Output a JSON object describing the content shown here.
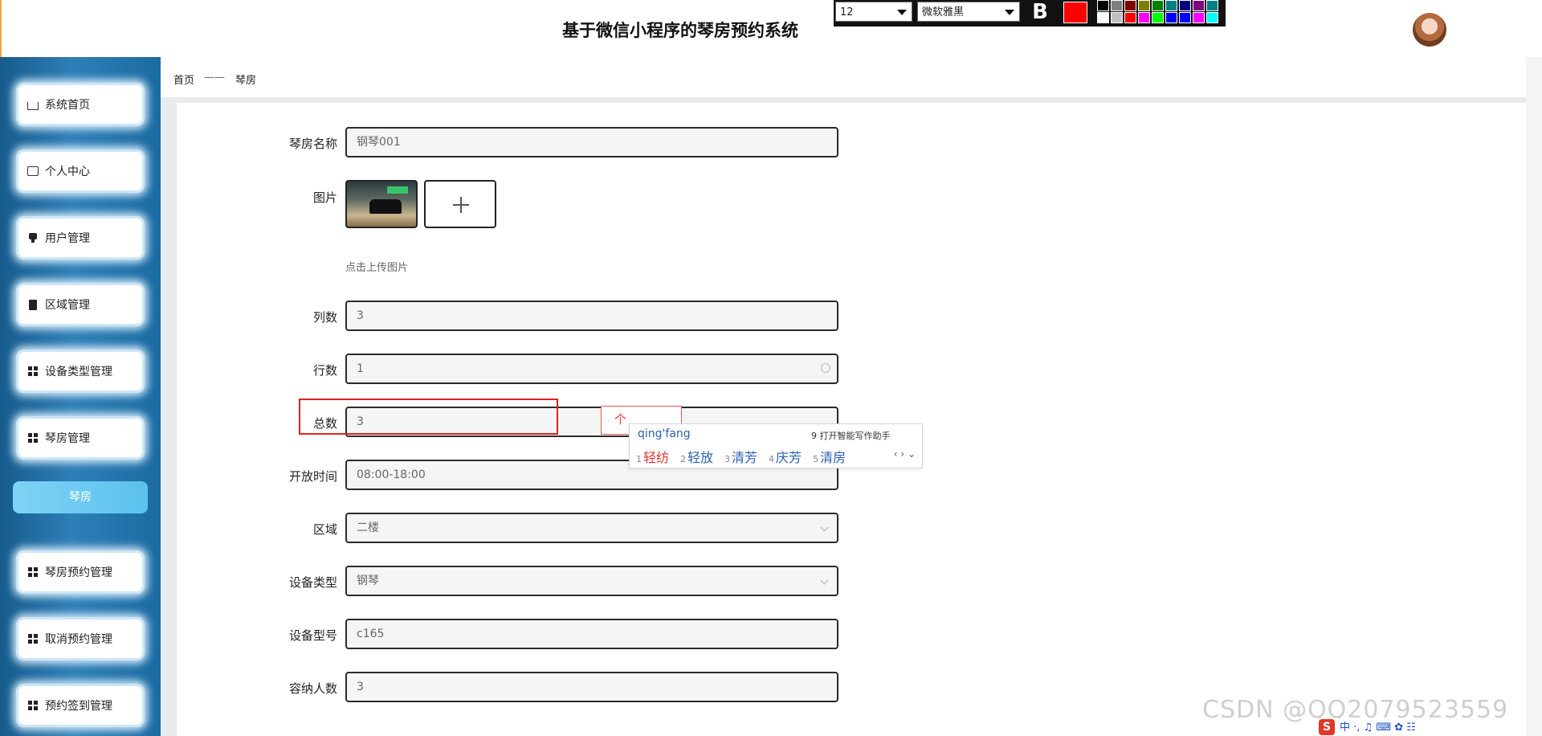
{
  "header": {
    "title": "基于微信小程序的琴房预约系统"
  },
  "text_toolbar": {
    "font_size": "12",
    "font_family": "微软雅黑",
    "bold_label": "B",
    "current_color": "#ff0000",
    "palette": [
      "#000000",
      "#808080",
      "#800000",
      "#808000",
      "#008000",
      "#008080",
      "#000080",
      "#800080",
      "#008080",
      "#ffffff",
      "#c0c0c0",
      "#ff0000",
      "#ff00ff",
      "#00ff00",
      "#0000ff",
      "#0000ff",
      "#ff00ff",
      "#00ffff"
    ]
  },
  "sidebar": {
    "items": [
      {
        "label": "系统首页",
        "icon": "home-icon"
      },
      {
        "label": "个人中心",
        "icon": "card-icon"
      },
      {
        "label": "用户管理",
        "icon": "user-icon"
      },
      {
        "label": "区域管理",
        "icon": "clipboard-icon"
      },
      {
        "label": "设备类型管理",
        "icon": "grid-icon"
      },
      {
        "label": "琴房管理",
        "icon": "grid-icon"
      },
      {
        "label": "琴房预约管理",
        "icon": "grid-icon"
      },
      {
        "label": "取消预约管理",
        "icon": "grid-icon"
      },
      {
        "label": "预约签到管理",
        "icon": "grid-icon"
      }
    ],
    "active_sub": "琴房"
  },
  "breadcrumb": {
    "home": "首页",
    "sep": "——",
    "current": "琴房"
  },
  "form": {
    "name_label": "琴房名称",
    "name_value": "钢琴001",
    "image_label": "图片",
    "upload_hint": "点击上传图片",
    "cols_label": "列数",
    "cols_value": "3",
    "rows_label": "行数",
    "rows_value": "1",
    "total_label": "总数",
    "total_value": "3",
    "hours_label": "开放时间",
    "hours_value": "08:00-18:00",
    "area_label": "区域",
    "area_value": "二楼",
    "device_type_label": "设备类型",
    "device_type_value": "钢琴",
    "device_model_label": "设备型号",
    "device_model_value": "c165",
    "capacity_label": "容纳人数",
    "capacity_value": "3"
  },
  "ime": {
    "preedit": "个",
    "pinyin": "qing'fang",
    "assist": "9 打开智能写作助手",
    "candidates": [
      {
        "n": "1",
        "text": "轻纺"
      },
      {
        "n": "2",
        "text": "轻放"
      },
      {
        "n": "3",
        "text": "清芳"
      },
      {
        "n": "4",
        "text": "庆芳"
      },
      {
        "n": "5",
        "text": "清房"
      }
    ],
    "nav": "‹ › ⌄",
    "tray_logo": "S",
    "tray_text": "中 ·, ♫ ⌨ ✿ ☷"
  },
  "watermark": "CSDN @QQ2079523559"
}
